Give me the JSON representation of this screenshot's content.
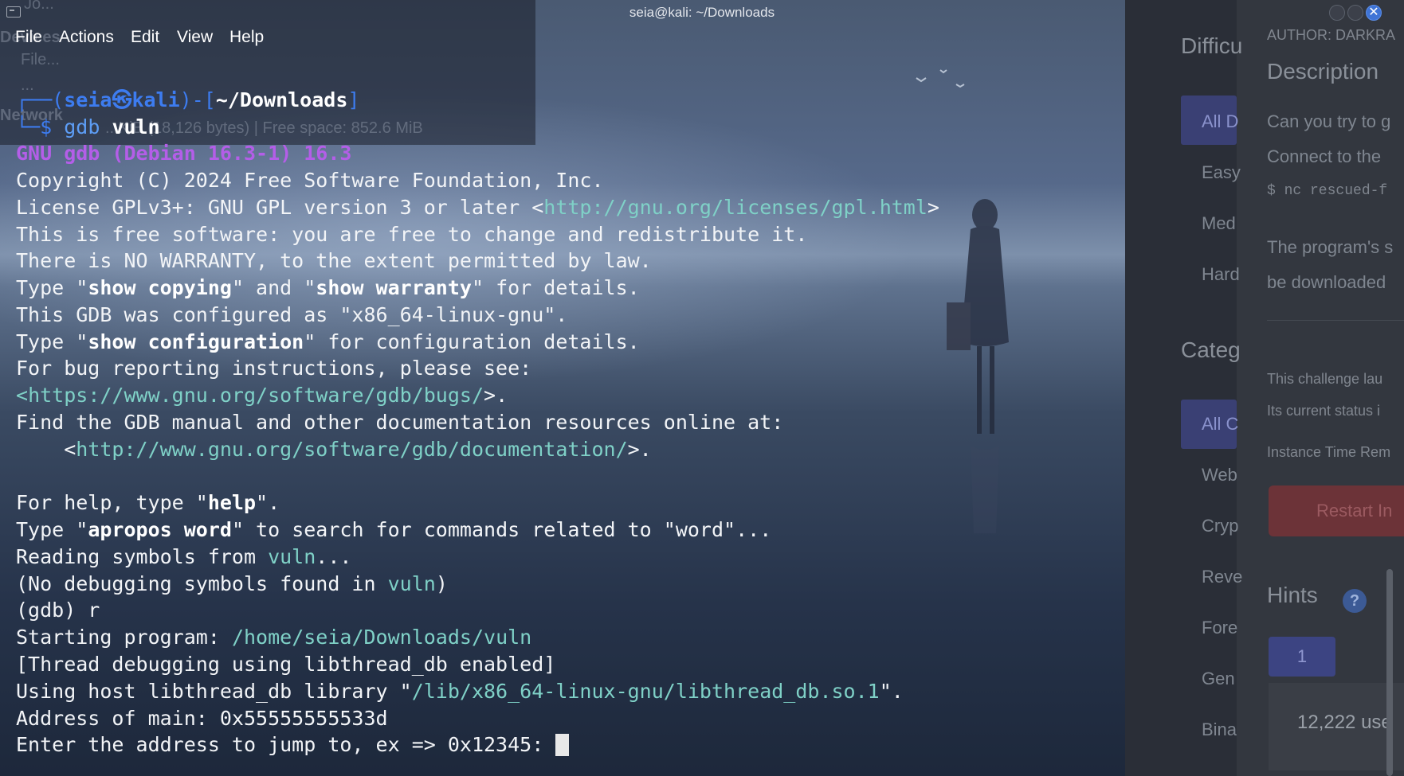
{
  "window": {
    "title": "seia@kali: ~/Downloads"
  },
  "menu": [
    "File",
    "Actions",
    "Edit",
    "View",
    "Help"
  ],
  "prompt": {
    "open": "┌──(",
    "user": "seia",
    "at": "㉿",
    "host": "kali",
    "close": ")-[",
    "cwd": "~/Downloads",
    "end": "]",
    "line2_prefix": "└─$ ",
    "command": "gdb",
    "argument": "vuln"
  },
  "terminal": {
    "gdb_banner": "GNU gdb (Debian 16.3-1) 16.3",
    "copyright": "Copyright (C) 2024 Free Software Foundation, Inc.",
    "license_pre": "License GPLv3+: GNU GPL version 3 or later <",
    "license_url": "http://gnu.org/licenses/gpl.html",
    "license_post": ">",
    "free_software": "This is free software: you are free to change and redistribute it.",
    "no_warranty": "There is NO WARRANTY, to the extent permitted by law.",
    "type1_a": "Type \"",
    "type1_b": "show copying",
    "type1_c": "\" and \"",
    "type1_d": "show warranty",
    "type1_e": "\" for details.",
    "configured": "This GDB was configured as \"x86_64-linux-gnu\".",
    "type2_a": "Type \"",
    "type2_b": "show configuration",
    "type2_c": "\" for configuration details.",
    "bug_reporting": "For bug reporting instructions, please see:",
    "bugs_pre": "<",
    "bugs_url": "https://www.gnu.org/software/gdb/bugs/",
    "bugs_post": ">.",
    "find_manual": "Find the GDB manual and other documentation resources online at:",
    "doc_pre": "    <",
    "doc_url": "http://www.gnu.org/software/gdb/documentation/",
    "doc_post": ">.",
    "help_a": "For help, type \"",
    "help_b": "help",
    "help_c": "\".",
    "apropos_a": "Type \"",
    "apropos_b": "apropos word",
    "apropos_c": "\" to search for commands related to \"word\"...",
    "reading_a": "Reading symbols from ",
    "reading_b": "vuln",
    "reading_c": "...",
    "nodebug_a": "(No debugging symbols found in ",
    "nodebug_b": "vuln",
    "nodebug_c": ")",
    "gdb_run": "(gdb) r",
    "starting_a": "Starting program: ",
    "starting_b": "/home/seia/Downloads/vuln",
    "thread_debug": "[Thread debugging using libthread_db enabled]",
    "host_lib_a": "Using host libthread_db library \"",
    "host_lib_b": "/lib/x86_64-linux-gnu/libthread_db.so.1",
    "host_lib_c": "\".",
    "address_main": "Address of main: 0x55555555533d",
    "enter_address": "Enter the address to jump to, ex => 0x12345: "
  },
  "file_manager_ghost": {
    "tab": "Jo...",
    "devices": "Devices",
    "item1": "File...",
    "item2": "...",
    "network": "Network",
    "status": "...KiB (18,126 bytes) | Free space: 852.6 MiB"
  },
  "web_panel": {
    "author": "AUTHOR: DARKRA",
    "difficulty_heading": "Difficu",
    "description_heading": "Description",
    "desc_line1": "Can you try to g",
    "desc_line2": "Connect to the",
    "desc_cmd": "$ nc rescued-f",
    "desc_line3": "The program's s",
    "desc_line4": "be downloaded",
    "difficulty_items": [
      "All D",
      "Easy",
      "Med",
      "Hard"
    ],
    "category_heading": "Categ",
    "category_items": [
      "All C",
      "Web",
      "Cryp",
      "Reve",
      "Fore",
      "Gen",
      "Bina"
    ],
    "launch_line1": "This challenge lau",
    "launch_line2": "Its current status i",
    "time_remaining": "Instance Time Rem",
    "restart_button": "Restart In",
    "hints_heading": "Hints",
    "hints_help": "?",
    "hint_button": "1",
    "users": "12,222 use"
  }
}
